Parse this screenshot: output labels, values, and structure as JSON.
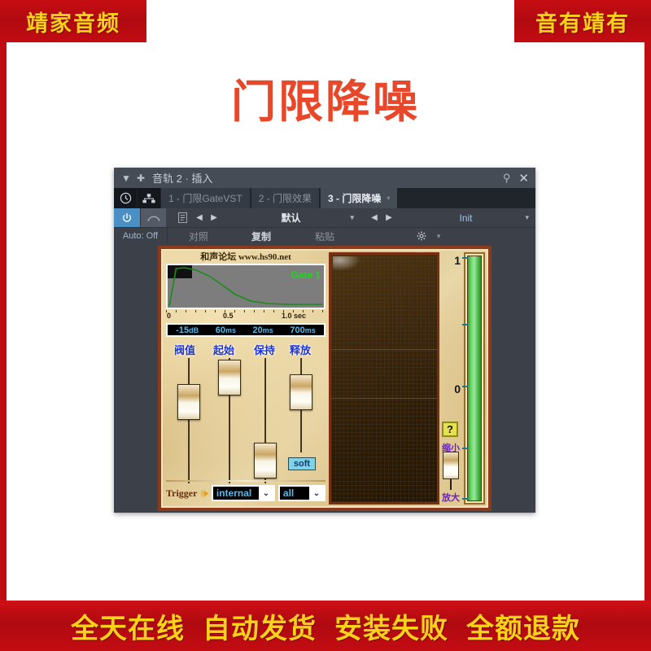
{
  "banners": {
    "top_left": "靖家音频",
    "top_right": "音有靖有",
    "bottom": [
      "全天在线",
      "自动发货",
      "安装失败",
      "全额退款"
    ]
  },
  "page_title": "门限降噪",
  "colors": {
    "banner_red": "#bf0d14",
    "banner_yellow": "#ffd21a",
    "title_red": "#e8472a",
    "accent_blue": "#4a90c4",
    "meter_green": "#4cb94c",
    "scope_red_line": "#e01010"
  },
  "plugin_window": {
    "titlebar": {
      "collapse_icon": "triangle-down-icon",
      "add_icon": "plus-icon",
      "title": "音轨 2 · 插入",
      "pin_icon": "pin-icon",
      "close_icon": "close-icon"
    },
    "tabs_row": {
      "clock_icon": "clock-icon",
      "routing_icon": "routing-icon",
      "tabs": [
        {
          "label": "1 - 门限GateVST",
          "active": false
        },
        {
          "label": "2 - 门限效果",
          "active": false
        },
        {
          "label": "3 - 门限降噪",
          "active": true
        }
      ],
      "tab_caret": "▾"
    },
    "toolbar_row1": {
      "power_icon": "power-icon",
      "bypass_icon": "bypass-icon",
      "list_icon": "list-icon",
      "prev_icon": "◀",
      "next_icon": "▶",
      "preset_name": "默认",
      "preset_dropdown_icon": "▾",
      "program_prev_icon": "◀",
      "program_next_icon": "▶",
      "program_name": "Init",
      "program_dropdown_icon": "▾"
    },
    "toolbar_row2": {
      "auto_status": "Auto: Off",
      "compare_label": "对照",
      "copy_label": "复制",
      "paste_label": "粘贴",
      "gear_icon": "gear-icon",
      "gear_dropdown_icon": "▾"
    }
  },
  "plugin_gui": {
    "watermark": "和声论坛 www.hs90.net",
    "graph": {
      "series_label": "Gate 1",
      "axis_ticks": [
        "0",
        "0.5",
        "1.0 sec"
      ],
      "envelope_points": [
        [
          0,
          0
        ],
        [
          0.08,
          1.0
        ],
        [
          0.18,
          0.95
        ],
        [
          0.32,
          0.7
        ],
        [
          0.48,
          0.42
        ],
        [
          0.62,
          0.2
        ],
        [
          0.75,
          0.08
        ],
        [
          0.9,
          0.04
        ],
        [
          1.0,
          0.03
        ]
      ]
    },
    "readout": [
      {
        "value": "-15",
        "unit": "dB"
      },
      {
        "value": "60",
        "unit": "ms"
      },
      {
        "value": "20",
        "unit": "ms"
      },
      {
        "value": "700",
        "unit": "ms"
      }
    ],
    "sliders": [
      {
        "label": "阀值",
        "value_pct": 62
      },
      {
        "label": "起始",
        "value_pct": 92
      },
      {
        "label": "保持",
        "value_pct": 18
      },
      {
        "label": "释放",
        "value_pct": 72
      }
    ],
    "soft_button": "soft",
    "trigger": {
      "label": "Trigger",
      "speaker_icon": "speaker-icon",
      "source": "internal",
      "source_dropdown_icon": "⌄",
      "channel": "all",
      "channel_dropdown_icon": "⌄"
    },
    "scope": {
      "scale_top": "1",
      "scale_mid": "0",
      "threshold_lines": 2
    },
    "help_button": "?",
    "zoom_out_label": "缩小",
    "zoom_in_label": "放大",
    "meter": {
      "level_pct": 100
    }
  }
}
